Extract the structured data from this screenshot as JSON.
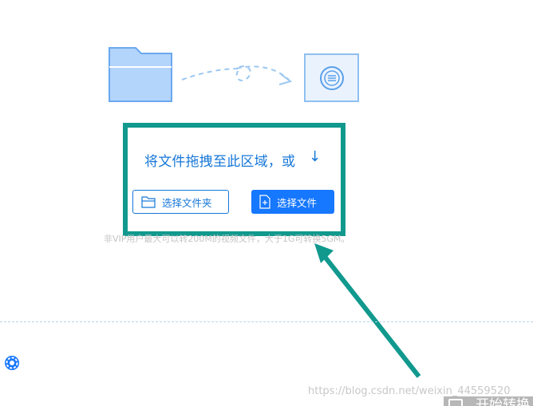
{
  "upload": {
    "prompt": "将文件拖拽至此区域，或",
    "arrow_icon": "arrow-down-icon",
    "folder_button_label": "选择文件夹",
    "file_button_label": "选择文件",
    "hint_text": "非VIP用户最大可以转200M的视频文件，大于1G可转换5GM。"
  },
  "footer": {
    "watermark": "https://blog.csdn.net/weixin_44559520",
    "start_button_label": "开始转换"
  },
  "icons": {
    "source": "folder-icon",
    "target": "convert-icon",
    "settings": "gear-icon"
  },
  "colors": {
    "accent_blue": "#1677ff",
    "annotation_teal": "#11998e",
    "folder_fill": "#b3d4fb",
    "hint_gray": "#c4c4c4"
  }
}
